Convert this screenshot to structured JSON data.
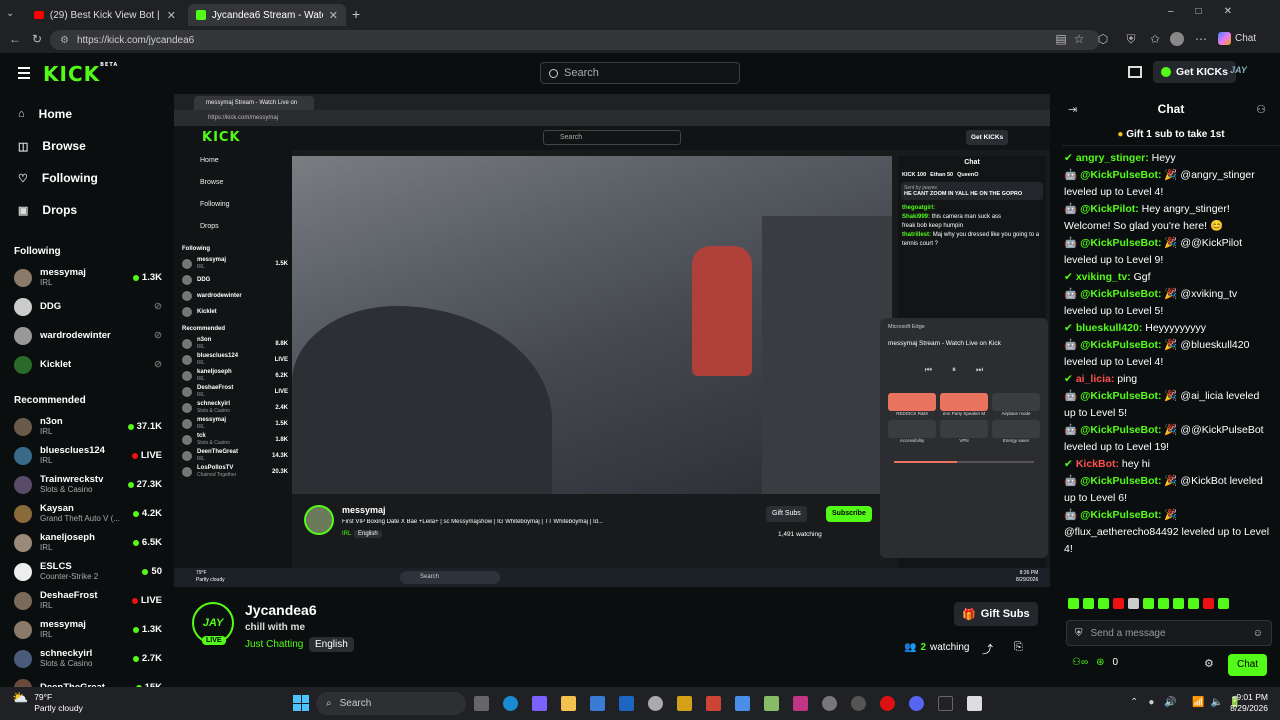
{
  "browser": {
    "tabs": [
      {
        "title": "(29) Best Kick View Bot | Views & I",
        "active": false
      },
      {
        "title": "Jycandea6 Stream - Watch Live on",
        "active": true
      }
    ],
    "url": "https://kick.com/jycandea6",
    "chat_label": "Chat"
  },
  "header": {
    "logo": "KICK",
    "logo_badge": "BETA",
    "search_placeholder": "Search",
    "get_kicks": "Get KICKs",
    "avatar_text": "JAY"
  },
  "sidebar": {
    "nav": [
      {
        "label": "Home",
        "icon": "home-icon"
      },
      {
        "label": "Browse",
        "icon": "browse-icon"
      },
      {
        "label": "Following",
        "icon": "heart-icon"
      },
      {
        "label": "Drops",
        "icon": "drops-icon"
      }
    ],
    "following_title": "Following",
    "following": [
      {
        "name": "messymaj",
        "category": "IRL",
        "viewers": "1.3K",
        "live": true
      },
      {
        "name": "DDG",
        "category": "",
        "viewers": "",
        "live": false
      },
      {
        "name": "wardrodewinter",
        "category": "",
        "viewers": "",
        "live": false
      },
      {
        "name": "Kicklet",
        "category": "",
        "viewers": "",
        "live": false
      }
    ],
    "recommended_title": "Recommended",
    "recommended": [
      {
        "name": "n3on",
        "category": "IRL",
        "viewers": "37.1K"
      },
      {
        "name": "bluesclues124",
        "category": "IRL",
        "viewers": "LIVE"
      },
      {
        "name": "Trainwreckstv",
        "category": "Slots & Casino",
        "viewers": "27.3K"
      },
      {
        "name": "Kaysan",
        "category": "Grand Theft Auto V (...",
        "viewers": "4.2K"
      },
      {
        "name": "kaneljoseph",
        "category": "IRL",
        "viewers": "6.5K"
      },
      {
        "name": "ESLCS",
        "category": "Counter-Strike 2",
        "viewers": "50"
      },
      {
        "name": "DeshaeFrost",
        "category": "IRL",
        "viewers": "LIVE"
      },
      {
        "name": "messymaj",
        "category": "IRL",
        "viewers": "1.3K"
      },
      {
        "name": "schneckyirl",
        "category": "Slots & Casino",
        "viewers": "2.7K"
      },
      {
        "name": "DeenTheGreat",
        "category": "",
        "viewers": "15K"
      }
    ]
  },
  "inner": {
    "tab": "messymaj Stream - Watch Live on",
    "url": "https://kick.com/messymaj",
    "search": "Search",
    "get_kicks": "Get KICKs",
    "nav": [
      "Home",
      "Browse",
      "Following",
      "Drops"
    ],
    "following_title": "Following",
    "following": [
      {
        "name": "messymaj",
        "cat": "IRL",
        "v": "1.5K"
      },
      {
        "name": "DDG",
        "cat": "",
        "v": ""
      },
      {
        "name": "wardrodewinter",
        "cat": "",
        "v": ""
      },
      {
        "name": "Kicklet",
        "cat": "",
        "v": ""
      }
    ],
    "recommended_title": "Recommended",
    "recommended": [
      {
        "name": "n3on",
        "cat": "IRL",
        "v": "8.8K"
      },
      {
        "name": "bluesclues124",
        "cat": "IRL",
        "v": "LIVE"
      },
      {
        "name": "kaneljoseph",
        "cat": "IRL",
        "v": "6.2K"
      },
      {
        "name": "DeshaeFrost",
        "cat": "IRL",
        "v": "LIVE"
      },
      {
        "name": "schneckyirl",
        "cat": "Slots & Casino",
        "v": "2.4K"
      },
      {
        "name": "messymaj",
        "cat": "IRL",
        "v": "1.5K"
      },
      {
        "name": "tck",
        "cat": "Slots & Casino",
        "v": "1.8K"
      },
      {
        "name": "DeenTheGreat",
        "cat": "IRL",
        "v": "14.3K"
      },
      {
        "name": "LosPollosTV",
        "cat": "Chained Together",
        "v": "20.3K"
      }
    ],
    "streamer": "messymaj",
    "stream_title": "First VIP Boxing Date X Bae +Leila+ | sc Messymajshow | IG Whiteboymaj | TT Whiteboymaj | Id...",
    "tags": [
      "IRL",
      "English"
    ],
    "gift_subs": "Gift Subs",
    "subscribe": "Subscribe",
    "watching": "1,491 watching",
    "chat_title": "Chat",
    "leaders": [
      {
        "name": "KICK",
        "v": "100"
      },
      {
        "name": "Ethan",
        "v": "50"
      },
      {
        "name": "QueenO",
        "v": ""
      }
    ],
    "pinned_by": "Sent by jaayee",
    "pinned_text": "HE CANT ZOOM IN YALL HE ON THE GOPRO",
    "chat": [
      {
        "u": "thegoatgirl:",
        "t": ""
      },
      {
        "u": "Shaki999:",
        "t": "this camera man suck ass"
      },
      {
        "u": "",
        "t": "freak bob keep humpin"
      },
      {
        "u": "thatrillest:",
        "t": "Maj why you dressed like you going to a tennis court ?"
      }
    ],
    "media_source": "Microsoft Edge",
    "media_title": "messymaj Stream - Watch Live on Kick",
    "quick": [
      "REDDICK R&M",
      "enn Party Speaker M",
      "Airplane mode",
      "Accessibility",
      "VPN",
      "Energy saver"
    ],
    "weather": "79°F",
    "weather_desc": "Partly cloudy",
    "search_taskbar": "Search",
    "time": "8:36 PM",
    "date": "8/29/2026"
  },
  "channel": {
    "name": "Jycandea6",
    "avatar_text": "JAY",
    "live_label": "LIVE",
    "title": "chill with me",
    "category": "Just Chatting",
    "language": "English",
    "gift_subs": "Gift Subs",
    "watching_count": "2",
    "watching_label": "watching"
  },
  "chat": {
    "title": "Chat",
    "gift_banner": "Gift 1 sub to take 1st",
    "messages": [
      {
        "user": "angry_stinger:",
        "text": "Heyy",
        "color": "#53fc18",
        "bot": false
      },
      {
        "user": "@KickPulseBot:",
        "text": "🎉 @angry_stinger leveled up to Level 4!",
        "color": "#53fc18",
        "bot": true
      },
      {
        "user": "@KickPilot:",
        "text": "Hey angry_stinger! Welcome! So glad you're here! 😊",
        "color": "#53fc18",
        "bot": true
      },
      {
        "user": "@KickPulseBot:",
        "text": "🎉 @@KickPilot leveled up to Level 9!",
        "color": "#53fc18",
        "bot": true
      },
      {
        "user": "xviking_tv:",
        "text": "Ggf",
        "color": "#53fc18",
        "bot": false
      },
      {
        "user": "@KickPulseBot:",
        "text": "🎉 @xviking_tv leveled up to Level 5!",
        "color": "#53fc18",
        "bot": true
      },
      {
        "user": "blueskull420:",
        "text": "Heyyyyyyyyy",
        "color": "#53fc18",
        "bot": false
      },
      {
        "user": "@KickPulseBot:",
        "text": "🎉 @blueskull420 leveled up to Level 4!",
        "color": "#53fc18",
        "bot": true
      },
      {
        "user": "ai_licia:",
        "text": "ping",
        "color": "#ff4f4f",
        "bot": false
      },
      {
        "user": "@KickPulseBot:",
        "text": "🎉 @ai_licia leveled up to Level 5!",
        "color": "#53fc18",
        "bot": true
      },
      {
        "user": "@KickPulseBot:",
        "text": "🎉 @@KickPulseBot leveled up to Level 19!",
        "color": "#53fc18",
        "bot": true
      },
      {
        "user": "KickBot:",
        "text": "hey hi",
        "color": "#ff4f4f",
        "bot": false
      },
      {
        "user": "@KickPulseBot:",
        "text": "🎉 @KickBot leveled up to Level 6!",
        "color": "#53fc18",
        "bot": true
      },
      {
        "user": "@KickPulseBot:",
        "text": "🎉 @flux_aetherecho84492 leveled up to Level 4!",
        "color": "#53fc18",
        "bot": true
      }
    ],
    "input_placeholder": "Send a message",
    "points": "0",
    "send_label": "Chat"
  },
  "taskbar": {
    "weather_temp": "79°F",
    "weather_desc": "Partly cloudy",
    "search": "Search",
    "time": "9:01 PM",
    "date": "8/29/2026"
  }
}
